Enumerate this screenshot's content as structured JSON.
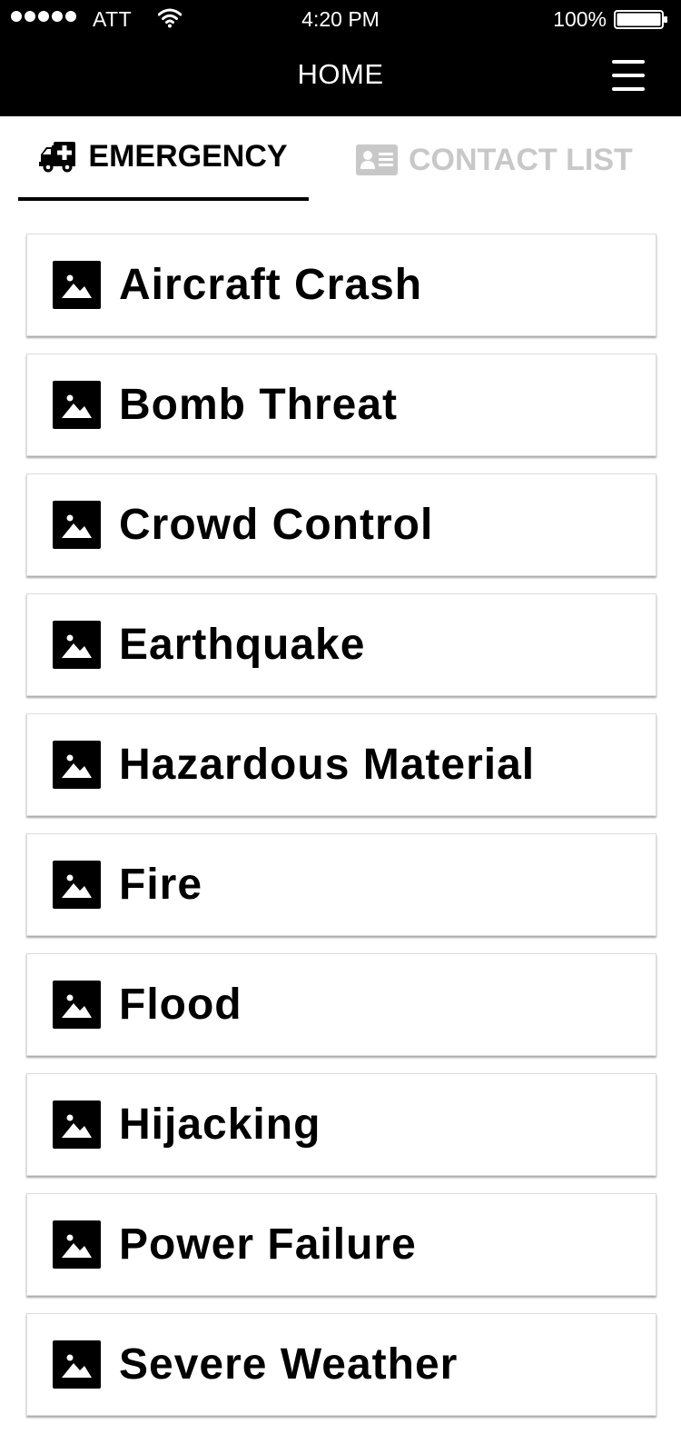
{
  "status_bar": {
    "carrier": "ATT",
    "time": "4:20 PM",
    "battery": "100%"
  },
  "header": {
    "title": "HOME"
  },
  "tabs": [
    {
      "label": "EMERGENCY",
      "icon": "ambulance-icon",
      "active": true
    },
    {
      "label": "CONTACT LIST",
      "icon": "contact-card-icon",
      "active": false
    }
  ],
  "emergencies": [
    {
      "label": "Aircraft Crash",
      "icon": "image-icon"
    },
    {
      "label": "Bomb Threat",
      "icon": "image-icon"
    },
    {
      "label": "Crowd Control",
      "icon": "image-icon"
    },
    {
      "label": "Earthquake",
      "icon": "image-icon"
    },
    {
      "label": "Hazardous Material",
      "icon": "image-icon"
    },
    {
      "label": "Fire",
      "icon": "image-icon"
    },
    {
      "label": "Flood",
      "icon": "image-icon"
    },
    {
      "label": "Hijacking",
      "icon": "image-icon"
    },
    {
      "label": "Power Failure",
      "icon": "image-icon"
    },
    {
      "label": "Severe Weather",
      "icon": "image-icon"
    }
  ],
  "colors": {
    "header_bg": "#000000",
    "active_tab": "#000000",
    "inactive_tab": "#c8c8c8"
  }
}
